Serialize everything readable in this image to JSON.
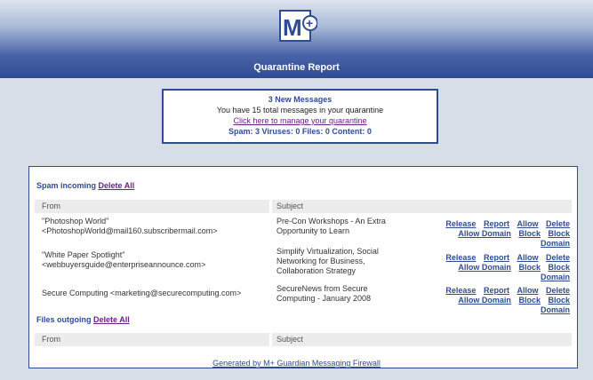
{
  "header": {
    "logo_text": "M+",
    "title": "Quarantine Report"
  },
  "summary": {
    "new_messages": "3 New Messages",
    "total_text": "You have 15 total messages in your quarantine",
    "manage_link": "Click here to manage your quarantine",
    "counts": "Spam: 3  Viruses: 0  Files: 0  Content: 0"
  },
  "spam_section": {
    "title": "Spam incoming",
    "delete_all": "Delete All",
    "col_from": "From",
    "col_subject": "Subject",
    "rows": [
      {
        "from_line1": "\"Photoshop World\"",
        "from_line2": "<PhotoshopWorld@mail160.subscribermail.com>",
        "subject_line1": "Pre-Con Workshops - An Extra",
        "subject_line2": "Opportunity to Learn",
        "subject_line3": ""
      },
      {
        "from_line1": "\"White Paper Spotlight\"",
        "from_line2": "<webbuyersguide@enterpriseannounce.com>",
        "subject_line1": "Simplify Virtualization, Social",
        "subject_line2": "Networking for Business,",
        "subject_line3": "Collaboration Strategy"
      },
      {
        "from_line1": "Secure Computing <marketing@securecomputing.com>",
        "from_line2": "",
        "subject_line1": "SecureNews from Secure",
        "subject_line2": "Computing - January 2008",
        "subject_line3": ""
      }
    ],
    "actions": {
      "release": "Release",
      "report": "Report",
      "allow": "Allow",
      "delete": "Delete",
      "allow_domain": "Allow Domain",
      "block": "Block",
      "block_domain": "Block Domain"
    }
  },
  "files_section": {
    "title": "Files outgoing",
    "delete_all": "Delete All",
    "col_from": "From",
    "col_subject": "Subject"
  },
  "footer": {
    "link": "Generated by M+ Guardian Messaging Firewall"
  },
  "colors": {
    "brand_blue": "#2f4b94",
    "link_purple": "#6a1f8a"
  }
}
